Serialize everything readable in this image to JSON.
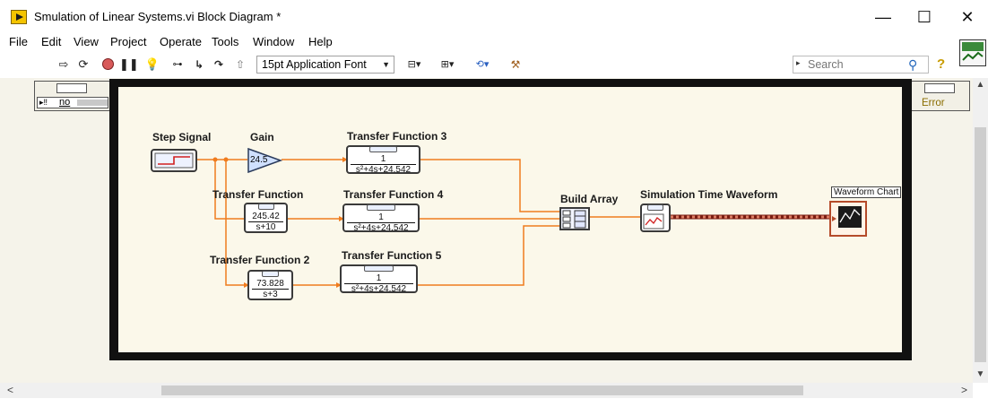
{
  "window": {
    "title": "Smulation of Linear Systems.vi Block Diagram *",
    "minimize_glyph": "—",
    "maximize_glyph": "☐",
    "close_glyph": "✕"
  },
  "menu": [
    "File",
    "Edit",
    "View",
    "Project",
    "Operate",
    "Tools",
    "Window",
    "Help"
  ],
  "toolbar": {
    "font_select": "15pt Application Font",
    "search_placeholder": "Search",
    "icons": [
      "run-arrow-icon",
      "run-continuously-icon",
      "abort-icon",
      "pause-icon",
      "highlight-execution-icon",
      "retain-wire-values-icon",
      "step-into-icon",
      "step-over-icon",
      "step-out-icon",
      "align-objects-icon",
      "distribute-objects-icon",
      "reorder-icon",
      "clean-up-diagram-icon",
      "help-icon"
    ]
  },
  "terminals": {
    "error_in_value": "no",
    "error_out_label": "Error"
  },
  "nodes": {
    "step_signal": "Step Signal",
    "gain": "Gain",
    "gain_value": "24.5",
    "tf": {
      "label": "Transfer Function",
      "num": "245.42",
      "den": "s+10"
    },
    "tf2": {
      "label": "Transfer Function 2",
      "num": "73.828",
      "den": "s+3"
    },
    "tf3": {
      "label": "Transfer Function 3",
      "num": "1",
      "den": "s²+4s+24.542"
    },
    "tf4": {
      "label": "Transfer Function 4",
      "num": "1",
      "den": "s²+4s+24.542"
    },
    "tf5": {
      "label": "Transfer Function 5",
      "num": "1",
      "den": "s²+4s+24.542"
    },
    "build_array": "Build Array",
    "sim_waveform": "Simulation Time Waveform",
    "waveform_chart": "Waveform Chart"
  },
  "colors": {
    "wire": "#f07c1e",
    "frame": "#111111",
    "diagram_bg": "#fbf8ea",
    "waveform_wire": "#b0342a"
  }
}
